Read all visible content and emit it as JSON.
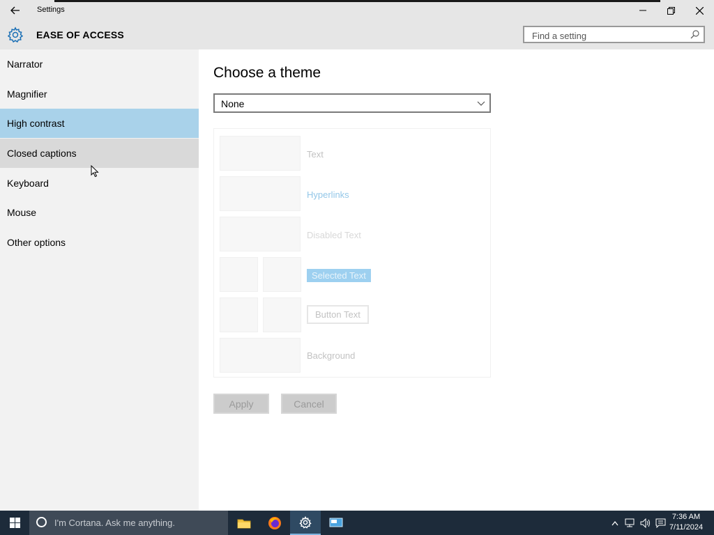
{
  "titlebar": {
    "app_title": "Settings",
    "buttons": [
      "back",
      "minimize",
      "restore",
      "close"
    ]
  },
  "header": {
    "section_title": "EASE OF ACCESS",
    "icon": "gear-icon",
    "search_placeholder": "Find a setting"
  },
  "sidebar": {
    "items": [
      {
        "label": "Narrator"
      },
      {
        "label": "Magnifier"
      },
      {
        "label": "High contrast",
        "state": "selected"
      },
      {
        "label": "Closed captions",
        "state": "hover"
      },
      {
        "label": "Keyboard"
      },
      {
        "label": "Mouse"
      },
      {
        "label": "Other options"
      }
    ]
  },
  "main": {
    "title": "Choose a theme",
    "theme_select": {
      "value": "None"
    },
    "preview": {
      "text": "Text",
      "hyperlinks": "Hyperlinks",
      "disabled_text": "Disabled Text",
      "selected_text": "Selected Text",
      "button_text": "Button Text",
      "background": "Background"
    },
    "apply_label": "Apply",
    "cancel_label": "Cancel"
  },
  "taskbar": {
    "cortana_placeholder": "I'm Cortana. Ask me anything.",
    "apps": [
      "file-explorer",
      "firefox",
      "settings",
      "remote-desktop"
    ],
    "time": "7:36 AM",
    "date": "7/11/2024"
  },
  "colors": {
    "selected_nav": "#a9d2ea",
    "hover_nav": "#d9d9d9",
    "accent": "#0078d7",
    "taskbar": "#1d2b3a"
  }
}
